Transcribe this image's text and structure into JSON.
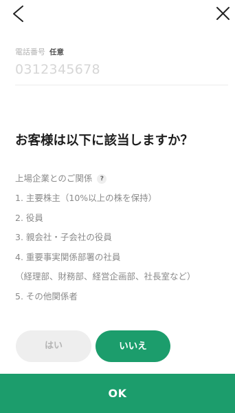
{
  "icons": {
    "back": "chevron-left-icon",
    "close": "close-icon",
    "help": "question-circle-icon"
  },
  "colors": {
    "accent": "#1c9d6c",
    "inactive_button": "#eeeeee"
  },
  "phone": {
    "label": "電話番号",
    "optional_badge": "任意",
    "placeholder": "0312345678",
    "value": ""
  },
  "question": {
    "heading": "お客様は以下に該当しますか？",
    "relation_label": "上場企業とのご関係",
    "help_glyph": "?",
    "items": [
      {
        "text": "1. 主要株主（10%以上の株を保持）"
      },
      {
        "text": "2. 役員"
      },
      {
        "text": "3. 親会社・子会社の役員"
      },
      {
        "text": "4. 重要事実関係部署の社員",
        "note": "（経理部、財務部、経営企画部、社長室など）"
      },
      {
        "text": "5. その他関係者"
      }
    ]
  },
  "answers": {
    "yes_label": "はい",
    "no_label": "いいえ",
    "yes_selected": false,
    "no_selected": true
  },
  "footer": {
    "ok_label": "OK"
  }
}
